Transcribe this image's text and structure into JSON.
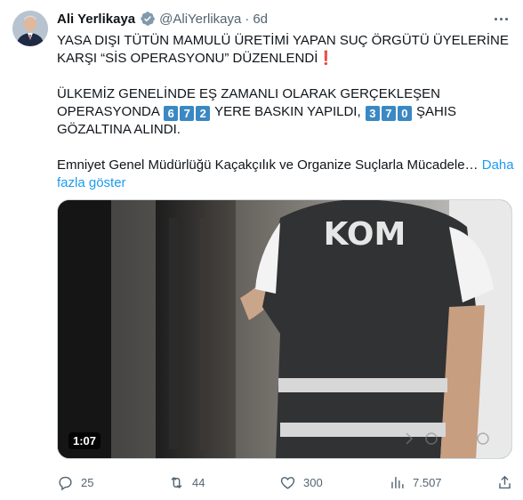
{
  "tweet": {
    "author_name": "Ali Yerlikaya",
    "handle": "@AliYerlikaya",
    "separator": "·",
    "time": "6d",
    "text_line1": "YASA DIŞI TÜTÜN MAMULÜ ÜRETİMİ YAPAN SUÇ ÖRGÜTÜ ÜYELERİNE KARŞI “SİS OPERASYONU” DÜZENLENDİ",
    "text_p2_a": "ÜLKEMİZ GENELİNDE EŞ ZAMANLI OLARAK GERÇEKLEŞEN OPERASYONDA",
    "num1": [
      "6",
      "7",
      "2"
    ],
    "text_p2_b": "YERE BASKIN YAPILDI,",
    "num2": [
      "3",
      "7",
      "0"
    ],
    "text_p2_c": "ŞAHIS GÖZALTINA ALINDI.",
    "text_p3": "Emniyet Genel Müdürlüğü Kaçakçılık ve Organize Suçlarla Mücadele…",
    "show_more": "Daha fazla göster",
    "video": {
      "vest_text": "KOM",
      "duration": "1:07"
    },
    "actions": {
      "replies": "25",
      "retweets": "44",
      "likes": "300",
      "views": "7.507"
    }
  },
  "colors": {
    "link": "#1d9bf0",
    "muted": "#536471",
    "keycap": "#3b88c3",
    "exclamation": "#dd2e44"
  }
}
